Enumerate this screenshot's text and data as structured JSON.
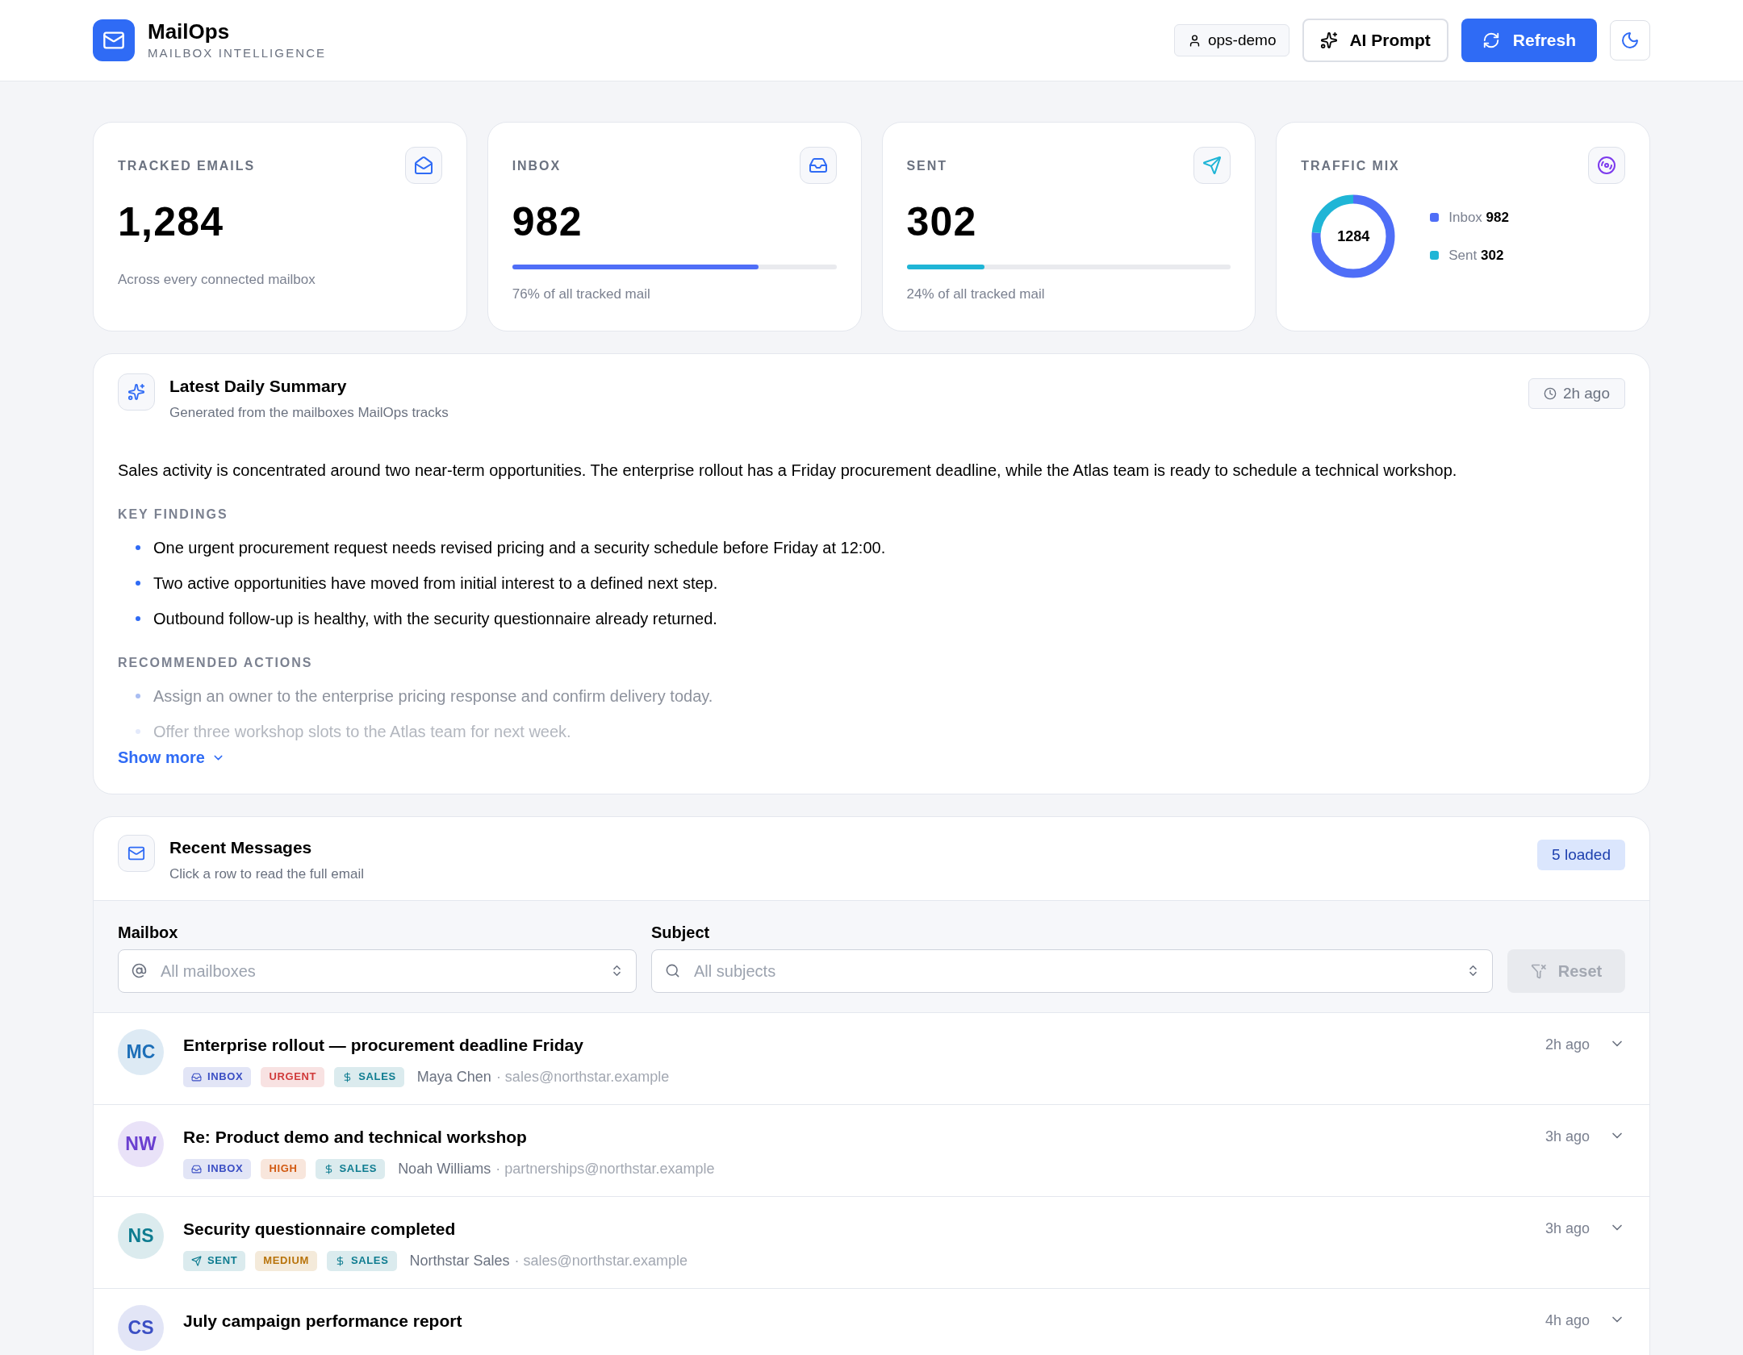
{
  "header": {
    "brand": "MailOps",
    "subtitle": "MAILBOX INTELLIGENCE",
    "user": "ops-demo",
    "ai_button": "AI Prompt",
    "refresh_button": "Refresh"
  },
  "stats": [
    {
      "kind": "total",
      "label": "TRACKED EMAILS",
      "value": "1,284",
      "note": "Across every connected mailbox"
    },
    {
      "kind": "inbox",
      "label": "INBOX",
      "value": "982",
      "level": 0.76,
      "color": "#4f6ef7",
      "note": "76% of all tracked mail"
    },
    {
      "kind": "sent",
      "label": "SENT",
      "value": "302",
      "level": 0.24,
      "color": "#1fb5d6",
      "note": "24% of all tracked mail"
    },
    {
      "kind": "mix",
      "label": "TRAFFIC MIX",
      "center": "1284",
      "legend": [
        {
          "label": "Inbox",
          "value": "982",
          "color": "#4f6ef7"
        },
        {
          "label": "Sent",
          "value": "302",
          "color": "#1fb5d6"
        }
      ]
    }
  ],
  "summary": {
    "title": "Latest Daily Summary",
    "subtitle": "Generated from the mailboxes MailOps tracks",
    "age": "2h ago",
    "text": "Sales activity is concentrated around two near-term opportunities. The enterprise rollout has a Friday procurement deadline, while the Atlas team is ready to schedule a technical workshop.",
    "sections": [
      {
        "title": "KEY FINDINGS",
        "items": [
          "One urgent procurement request needs revised pricing and a security schedule before Friday at 12:00.",
          "Two active opportunities have moved from initial interest to a defined next step.",
          "Outbound follow-up is healthy, with the security questionnaire already returned."
        ]
      },
      {
        "title": "RECOMMENDED ACTIONS",
        "items": [
          "Assign an owner to the enterprise pricing response and confirm delivery today.",
          "Offer three workshop slots to the Atlas team for next week."
        ]
      }
    ],
    "show_more": "Show more"
  },
  "messages": {
    "title": "Recent Messages",
    "subtitle": "Click a row to read the full email",
    "count": "5 loaded",
    "filters": {
      "mailbox_label": "Mailbox",
      "mailbox_placeholder": "All mailboxes",
      "subject_label": "Subject",
      "subject_placeholder": "All subjects",
      "reset": "Reset",
      "reset_disabled": true
    },
    "rows": [
      {
        "initials": "MC",
        "color": "#1d6fb8",
        "subject": "Enterprise rollout — procurement deadline Friday",
        "sender": "Maya Chen",
        "email": "· sales@northstar.example",
        "time": "2h ago",
        "tags": [
          {
            "kind": "inbox",
            "label": "INBOX",
            "color": "#3b4fc4"
          },
          {
            "kind": "priority",
            "label": "URGENT",
            "color": "#d03a3a"
          },
          {
            "kind": "category",
            "label": "SALES",
            "color": "#0e7c90"
          }
        ]
      },
      {
        "initials": "NW",
        "color": "#6a3fd0",
        "subject": "Re: Product demo and technical workshop",
        "sender": "Noah Williams",
        "email": "· partnerships@northstar.example",
        "time": "3h ago",
        "tags": [
          {
            "kind": "inbox",
            "label": "INBOX",
            "color": "#3b4fc4"
          },
          {
            "kind": "priority",
            "label": "HIGH",
            "color": "#d25a12"
          },
          {
            "kind": "category",
            "label": "SALES",
            "color": "#0e7c90"
          }
        ]
      },
      {
        "initials": "NS",
        "color": "#0e7c90",
        "subject": "Security questionnaire completed",
        "sender": "Northstar Sales",
        "email": "· sales@northstar.example",
        "time": "3h ago",
        "tags": [
          {
            "kind": "sent",
            "label": "SENT",
            "color": "#0e7c90"
          },
          {
            "kind": "priority",
            "label": "MEDIUM",
            "color": "#b8730a"
          },
          {
            "kind": "category",
            "label": "SALES",
            "color": "#0e7c90"
          }
        ]
      },
      {
        "initials": "CS",
        "color": "#3b4fc4",
        "subject": "July campaign performance report",
        "time": "4h ago",
        "tags": []
      }
    ]
  }
}
